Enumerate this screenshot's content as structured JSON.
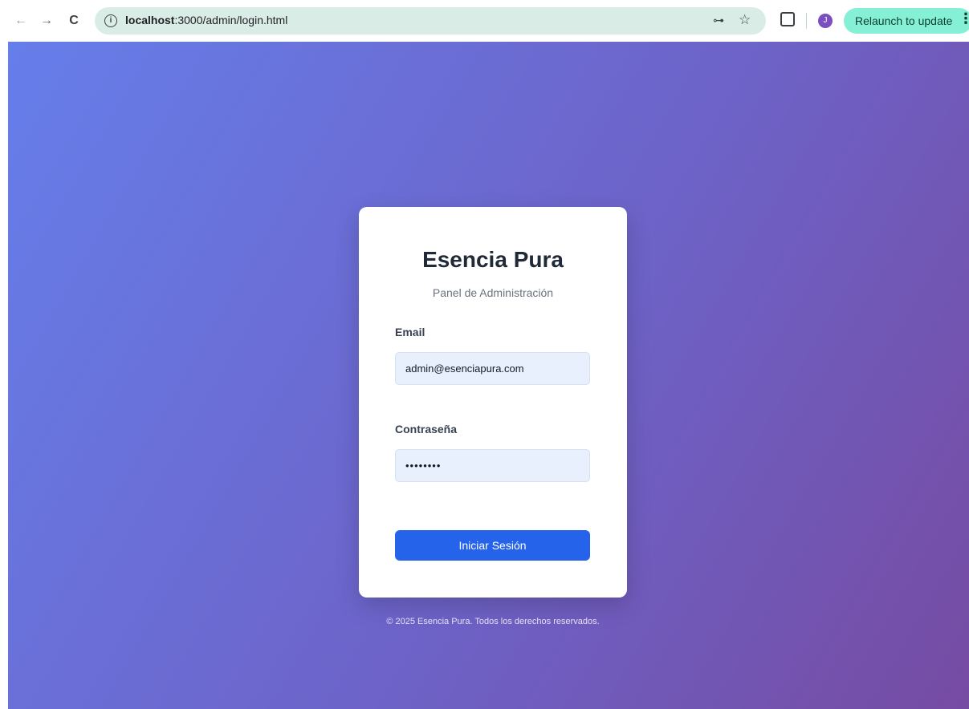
{
  "browser": {
    "back_glyph": "←",
    "forward_glyph": "→",
    "reload_glyph": "C",
    "url_host": "localhost",
    "url_path": ":3000/admin/login.html",
    "key_glyph": "⊶",
    "star_glyph": "☆",
    "avatar_initial": "J",
    "relaunch_label": "Relaunch to update",
    "menu_glyph": "⋮"
  },
  "login": {
    "title": "Esencia Pura",
    "subtitle": "Panel de Administración",
    "email_label": "Email",
    "email_value": "admin@esenciapura.com",
    "password_label": "Contraseña",
    "password_value": "••••••••",
    "submit_label": "Iniciar Sesión"
  },
  "footer": {
    "text": "© 2025 Esencia Pura. Todos los derechos reservados."
  },
  "colors": {
    "gradient_start": "#667eea",
    "gradient_end": "#764ba2",
    "button": "#2563eb",
    "input_bg": "#e8f0fe"
  }
}
